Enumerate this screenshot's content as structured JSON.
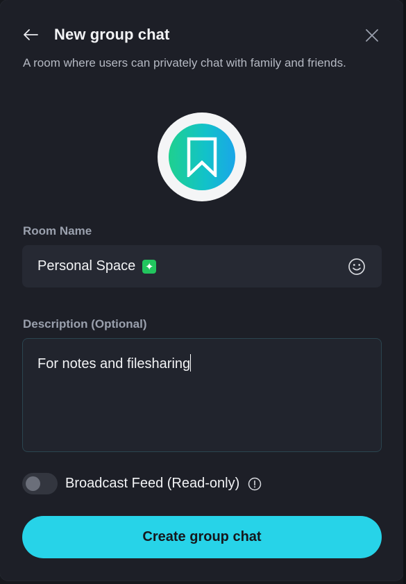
{
  "dialog": {
    "title": "New group chat",
    "subtitle": "A room where users can privately chat with family and friends."
  },
  "icons": {
    "back": "arrow-left-icon",
    "close": "close-icon",
    "avatar": "bookmark-icon",
    "emoji": "smiley-face-icon",
    "sparkle": "sparkle-icon",
    "info": "info-circle-icon"
  },
  "room_name": {
    "label": "Room Name",
    "value": "Personal Space",
    "emoji": "✦"
  },
  "description": {
    "label": "Description (Optional)",
    "value": "For notes and filesharing"
  },
  "broadcast": {
    "label": "Broadcast Feed (Read-only)",
    "enabled": false
  },
  "actions": {
    "create_label": "Create group chat"
  },
  "colors": {
    "background": "#1d1f27",
    "accent": "#27d3e8",
    "avatar_gradient_start": "#1fd08f",
    "avatar_gradient_end": "#1aa6e8",
    "sparkle": "#22c55e"
  }
}
